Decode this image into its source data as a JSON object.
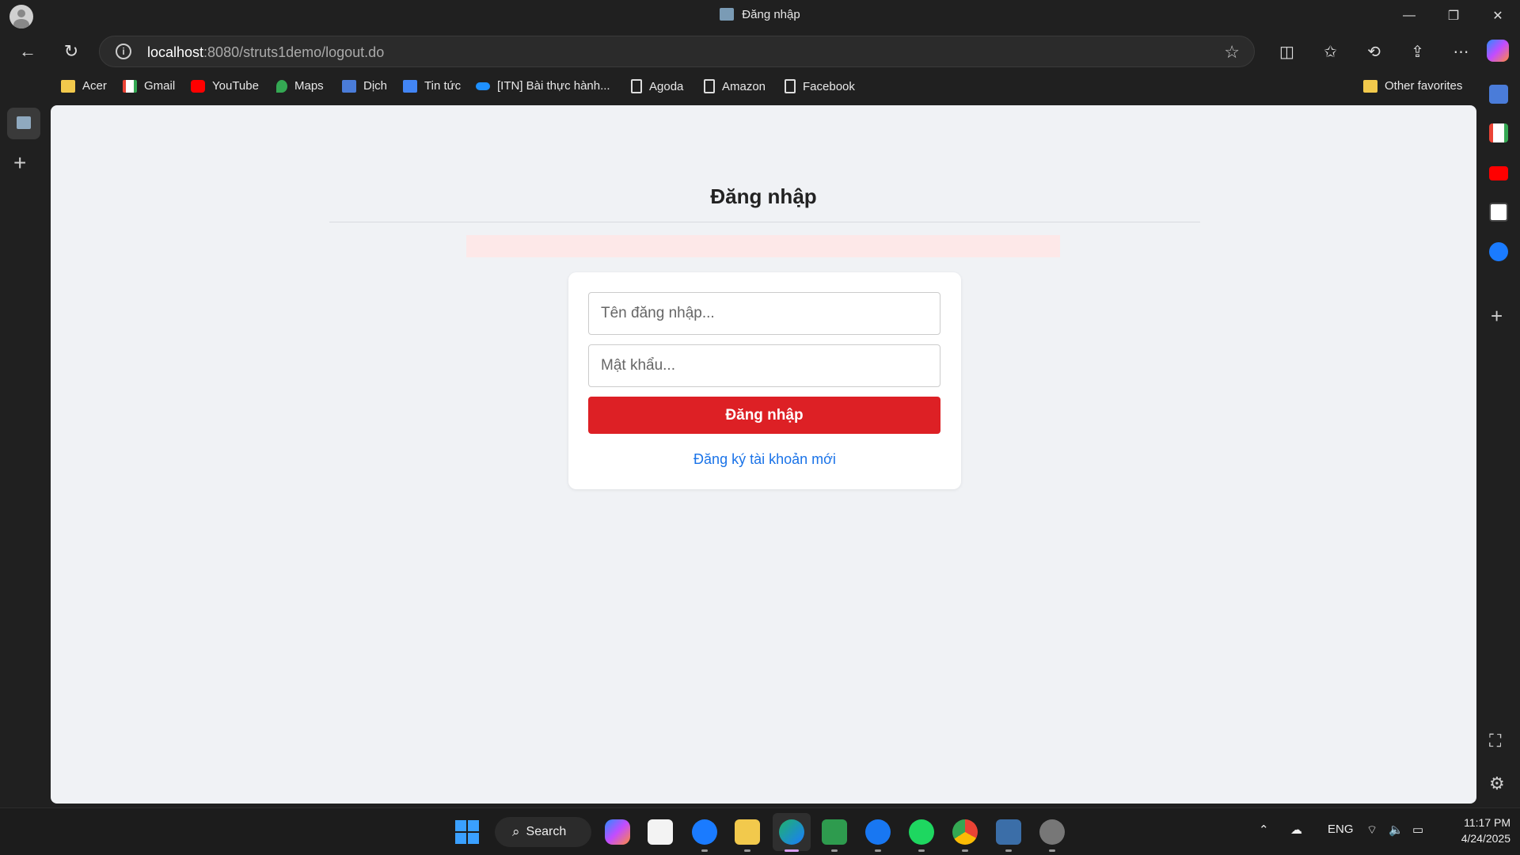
{
  "window": {
    "tab_title": "Đăng nhập",
    "controls": {
      "minimize": "—",
      "restore": "❐",
      "close": "✕"
    }
  },
  "addressbar": {
    "host": "localhost",
    "path": ":8080/struts1demo/logout.do"
  },
  "bookmarks": [
    {
      "label": "Acer",
      "icon": "folder-icon"
    },
    {
      "label": "Gmail",
      "icon": "gmail-icon"
    },
    {
      "label": "YouTube",
      "icon": "youtube-icon"
    },
    {
      "label": "Maps",
      "icon": "maps-icon"
    },
    {
      "label": "Dịch",
      "icon": "translate-icon"
    },
    {
      "label": "Tin tức",
      "icon": "news-icon"
    },
    {
      "label": "[ITN] Bài thực hành...",
      "icon": "onedrive-icon"
    },
    {
      "label": "Agoda",
      "icon": "document-icon"
    },
    {
      "label": "Amazon",
      "icon": "document-icon"
    },
    {
      "label": "Facebook",
      "icon": "document-icon"
    }
  ],
  "other_favorites": "Other favorites",
  "page": {
    "heading": "Đăng nhập",
    "username_placeholder": "Tên đăng nhập...",
    "password_placeholder": "Mật khẩu...",
    "login_button": "Đăng nhập",
    "register_link": "Đăng ký tài khoản mới"
  },
  "taskbar": {
    "search_label": "Search",
    "language": "ENG",
    "time": "11:17 PM",
    "date": "4/24/2025"
  },
  "colors": {
    "accent_red": "#dd2025",
    "link_blue": "#1a73e8",
    "page_bg": "#f0f2f5",
    "error_bg": "#fde8e8"
  }
}
